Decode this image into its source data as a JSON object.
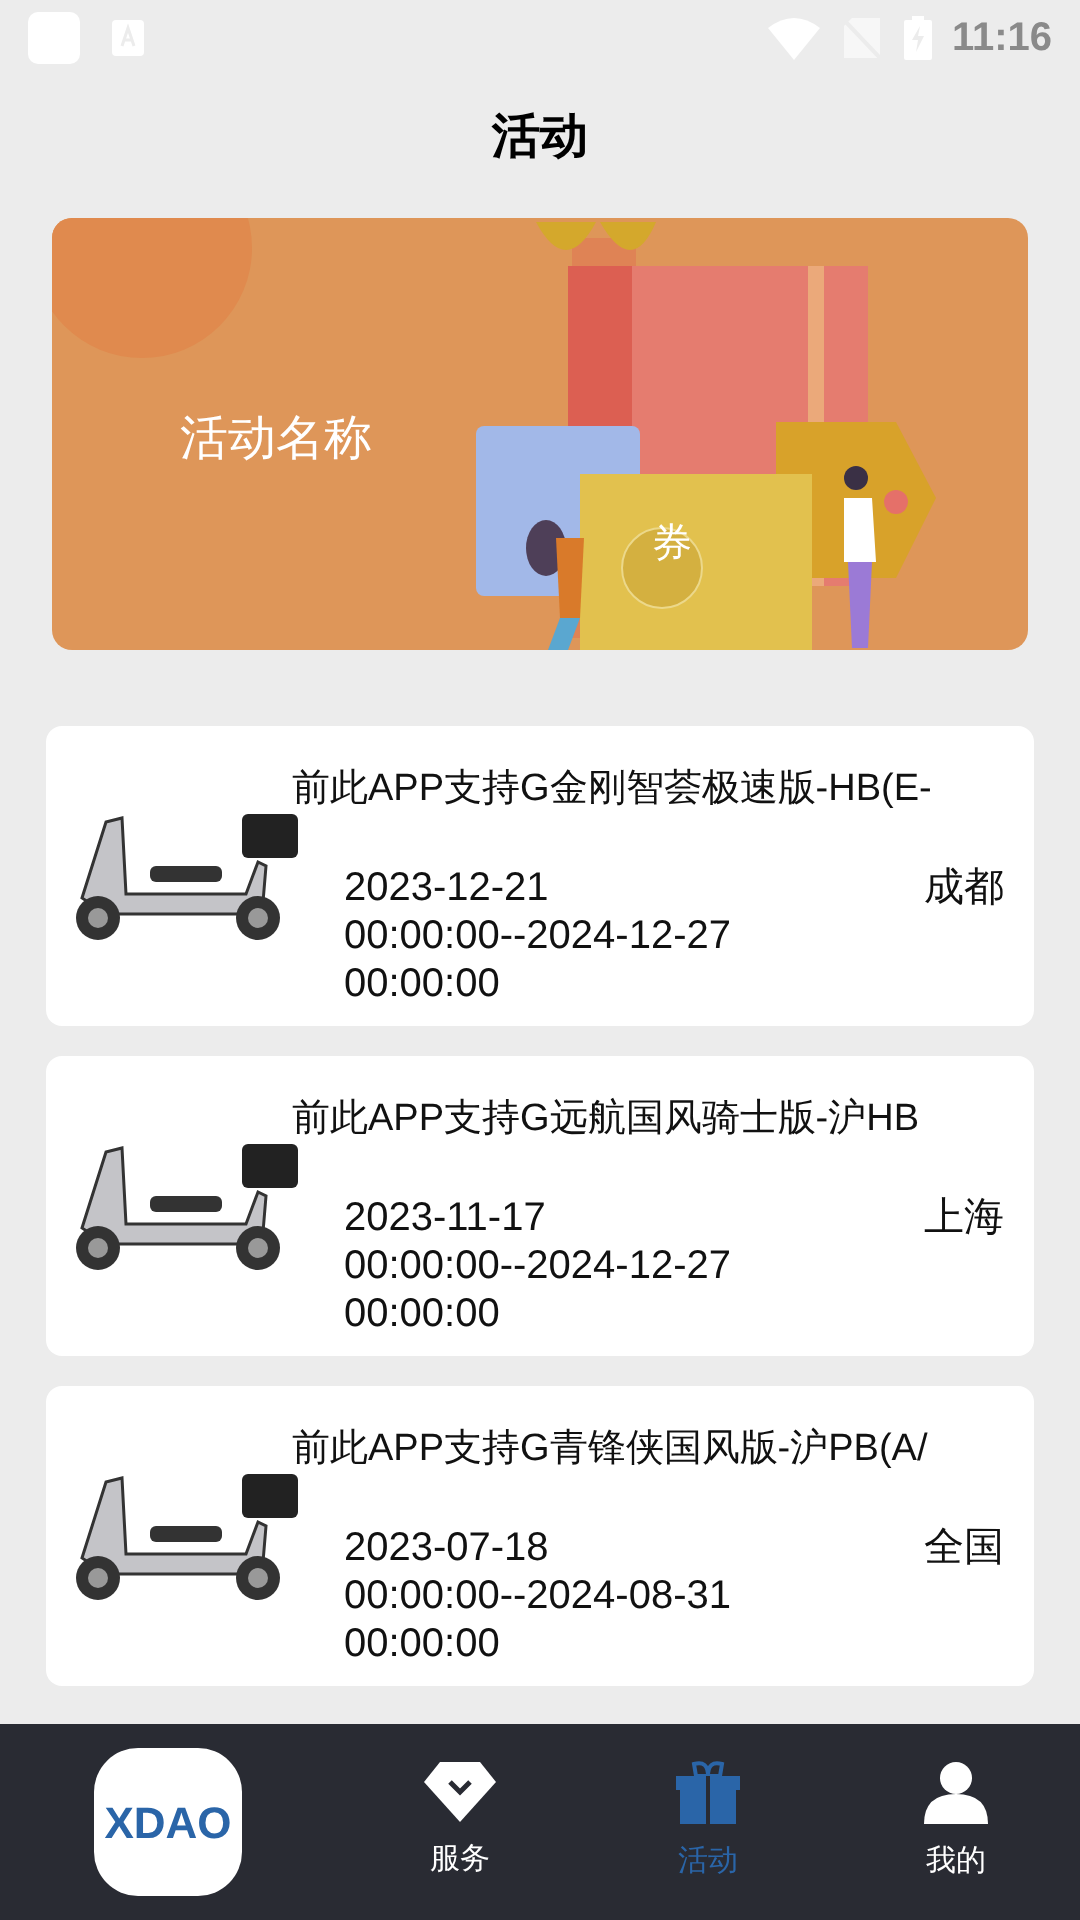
{
  "status_bar": {
    "time": "11:16"
  },
  "header": {
    "title": "活动"
  },
  "banner": {
    "title": "活动名称",
    "coupon_label": "券"
  },
  "activities": [
    {
      "title": "前此APP支持G金刚智荟极速版-HB(E-",
      "period_lines": [
        "2023-12-21",
        "00:00:00--2024-12-27",
        "00:00:00"
      ],
      "city": "成都"
    },
    {
      "title": "前此APP支持G远航国风骑士版-沪HB",
      "period_lines": [
        "2023-11-17",
        "00:00:00--2024-12-27",
        "00:00:00"
      ],
      "city": "上海"
    },
    {
      "title": "前此APP支持G青锋侠国风版-沪PB(A/",
      "period_lines": [
        "2023-07-18",
        "00:00:00--2024-08-31",
        "00:00:00"
      ],
      "city": "全国"
    }
  ],
  "nav": {
    "logo": "XDAO",
    "items": [
      {
        "kind": "service",
        "label": "服务",
        "selected": false
      },
      {
        "kind": "activity",
        "label": "活动",
        "selected": true
      },
      {
        "kind": "me",
        "label": "我的",
        "selected": false
      }
    ]
  }
}
